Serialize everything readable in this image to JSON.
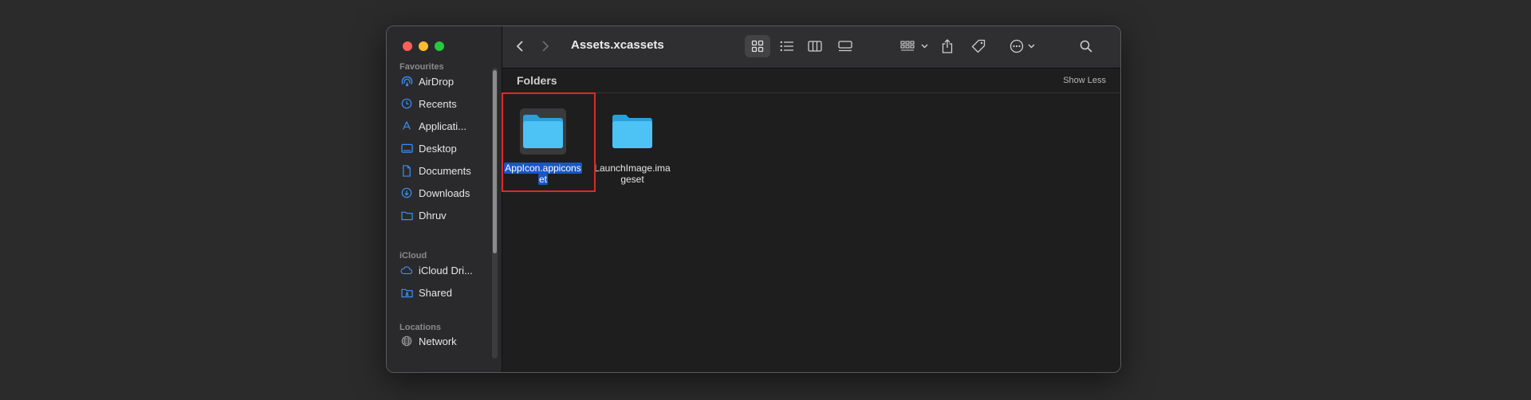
{
  "window": {
    "title": "Assets.xcassets"
  },
  "sidebar": {
    "sections": [
      {
        "heading": "Favourites"
      },
      {
        "heading": "iCloud"
      },
      {
        "heading": "Locations"
      }
    ],
    "favourites": [
      {
        "label": "AirDrop",
        "icon": "airdrop-icon"
      },
      {
        "label": "Recents",
        "icon": "clock-icon"
      },
      {
        "label": "Applicati...",
        "icon": "applications-icon"
      },
      {
        "label": "Desktop",
        "icon": "desktop-icon"
      },
      {
        "label": "Documents",
        "icon": "document-icon"
      },
      {
        "label": "Downloads",
        "icon": "download-icon"
      },
      {
        "label": "Dhruv",
        "icon": "folder-icon"
      }
    ],
    "icloud": [
      {
        "label": "iCloud Dri...",
        "icon": "cloud-icon"
      },
      {
        "label": "Shared",
        "icon": "shared-folder-icon"
      }
    ],
    "locations": [
      {
        "label": "Network",
        "icon": "globe-icon"
      }
    ]
  },
  "content": {
    "group_title": "Folders",
    "show_less_label": "Show Less",
    "items": [
      {
        "line1": "AppIcon.appicons",
        "line2": "et",
        "selected": true
      },
      {
        "line1": "LaunchImage.ima",
        "line2": "geset",
        "selected": false
      }
    ]
  },
  "colors": {
    "accent": "#1a56c8",
    "folder": "#4cc2f5",
    "highlight_border": "#e02828"
  }
}
